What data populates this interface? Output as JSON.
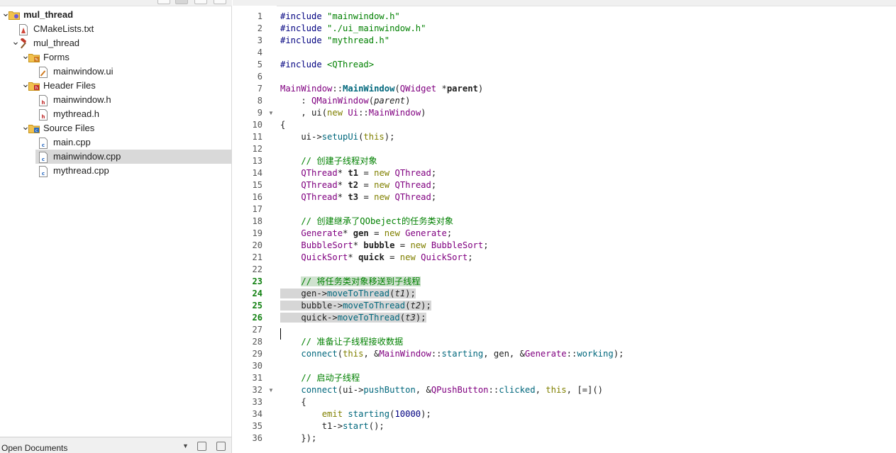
{
  "project_tree": [
    {
      "label": "mul_thread",
      "depth": 0,
      "arrow": "down",
      "icon": "project-icon",
      "bold": true
    },
    {
      "label": "CMakeLists.txt",
      "depth": 1,
      "arrow": "",
      "icon": "cmake-file-icon"
    },
    {
      "label": "mul_thread",
      "depth": 1,
      "arrow": "down",
      "icon": "hammer-icon"
    },
    {
      "label": "Forms",
      "depth": 2,
      "arrow": "down",
      "icon": "forms-folder-icon"
    },
    {
      "label": "mainwindow.ui",
      "depth": 3,
      "arrow": "",
      "icon": "ui-file-icon"
    },
    {
      "label": "Header Files",
      "depth": 2,
      "arrow": "down",
      "icon": "header-folder-icon"
    },
    {
      "label": "mainwindow.h",
      "depth": 3,
      "arrow": "",
      "icon": "header-file-icon"
    },
    {
      "label": "mythread.h",
      "depth": 3,
      "arrow": "",
      "icon": "header-file-icon"
    },
    {
      "label": "Source Files",
      "depth": 2,
      "arrow": "down",
      "icon": "source-folder-icon"
    },
    {
      "label": "main.cpp",
      "depth": 3,
      "arrow": "",
      "icon": "cpp-file-icon"
    },
    {
      "label": "mainwindow.cpp",
      "depth": 3,
      "arrow": "",
      "icon": "cpp-file-icon",
      "selected": true
    },
    {
      "label": "mythread.cpp",
      "depth": 3,
      "arrow": "",
      "icon": "cpp-file-icon"
    }
  ],
  "bottom_bar": {
    "label": "Open Documents"
  },
  "editor": {
    "current_lines": [
      23,
      24,
      25,
      26
    ],
    "lines": [
      {
        "n": 1,
        "tokens": [
          [
            "pp",
            "#include "
          ],
          [
            "str",
            "\"mainwindow.h\""
          ]
        ]
      },
      {
        "n": 2,
        "tokens": [
          [
            "pp",
            "#include "
          ],
          [
            "str",
            "\"./ui_mainwindow.h\""
          ]
        ]
      },
      {
        "n": 3,
        "tokens": [
          [
            "pp",
            "#include "
          ],
          [
            "str",
            "\"mythread.h\""
          ]
        ]
      },
      {
        "n": 4,
        "tokens": []
      },
      {
        "n": 5,
        "tokens": [
          [
            "pp",
            "#include "
          ],
          [
            "str",
            "<QThread>"
          ]
        ]
      },
      {
        "n": 6,
        "tokens": []
      },
      {
        "n": 7,
        "tokens": [
          [
            "ty",
            "MainWindow"
          ],
          [
            "",
            "::"
          ],
          [
            "fn b",
            "MainWindow"
          ],
          [
            "",
            "("
          ],
          [
            "ty",
            "QWidget"
          ],
          [
            "",
            " *"
          ],
          [
            "b",
            "parent"
          ],
          [
            "",
            ")"
          ]
        ]
      },
      {
        "n": 8,
        "tokens": [
          [
            "",
            "    : "
          ],
          [
            "ty",
            "QMainWindow"
          ],
          [
            "",
            "("
          ],
          [
            "it",
            "parent"
          ],
          [
            "",
            ")"
          ]
        ]
      },
      {
        "n": 9,
        "fold": true,
        "tokens": [
          [
            "",
            "    , ui("
          ],
          [
            "kw",
            "new"
          ],
          [
            "",
            " "
          ],
          [
            "ty",
            "Ui"
          ],
          [
            "",
            "::"
          ],
          [
            "ty",
            "MainWindow"
          ],
          [
            "",
            ")"
          ]
        ]
      },
      {
        "n": 10,
        "tokens": [
          [
            "",
            "{"
          ]
        ]
      },
      {
        "n": 11,
        "tokens": [
          [
            "",
            "    ui->"
          ],
          [
            "fn",
            "setupUi"
          ],
          [
            "",
            "("
          ],
          [
            "kw",
            "this"
          ],
          [
            "",
            ");"
          ]
        ]
      },
      {
        "n": 12,
        "tokens": []
      },
      {
        "n": 13,
        "tokens": [
          [
            "cmt",
            "    // 创建子线程对象"
          ]
        ]
      },
      {
        "n": 14,
        "tokens": [
          [
            "",
            "    "
          ],
          [
            "ty",
            "QThread"
          ],
          [
            "",
            "* "
          ],
          [
            "b",
            "t1"
          ],
          [
            "",
            " = "
          ],
          [
            "kw",
            "new"
          ],
          [
            "",
            " "
          ],
          [
            "ty",
            "QThread"
          ],
          [
            "",
            ";"
          ]
        ]
      },
      {
        "n": 15,
        "tokens": [
          [
            "",
            "    "
          ],
          [
            "ty",
            "QThread"
          ],
          [
            "",
            "* "
          ],
          [
            "b",
            "t2"
          ],
          [
            "",
            " = "
          ],
          [
            "kw",
            "new"
          ],
          [
            "",
            " "
          ],
          [
            "ty",
            "QThread"
          ],
          [
            "",
            ";"
          ]
        ]
      },
      {
        "n": 16,
        "tokens": [
          [
            "",
            "    "
          ],
          [
            "ty",
            "QThread"
          ],
          [
            "",
            "* "
          ],
          [
            "b",
            "t3"
          ],
          [
            "",
            " = "
          ],
          [
            "kw",
            "new"
          ],
          [
            "",
            " "
          ],
          [
            "ty",
            "QThread"
          ],
          [
            "",
            ";"
          ]
        ]
      },
      {
        "n": 17,
        "tokens": []
      },
      {
        "n": 18,
        "tokens": [
          [
            "cmt",
            "    // 创建继承了QObeject的任务类对象"
          ]
        ]
      },
      {
        "n": 19,
        "tokens": [
          [
            "",
            "    "
          ],
          [
            "ty",
            "Generate"
          ],
          [
            "",
            "* "
          ],
          [
            "b",
            "gen"
          ],
          [
            "",
            " = "
          ],
          [
            "kw",
            "new"
          ],
          [
            "",
            " "
          ],
          [
            "ty",
            "Generate"
          ],
          [
            "",
            ";"
          ]
        ]
      },
      {
        "n": 20,
        "tokens": [
          [
            "",
            "    "
          ],
          [
            "ty",
            "BubbleSort"
          ],
          [
            "",
            "* "
          ],
          [
            "b",
            "bubble"
          ],
          [
            "",
            " = "
          ],
          [
            "kw",
            "new"
          ],
          [
            "",
            " "
          ],
          [
            "ty",
            "BubbleSort"
          ],
          [
            "",
            ";"
          ]
        ]
      },
      {
        "n": 21,
        "tokens": [
          [
            "",
            "    "
          ],
          [
            "ty",
            "QuickSort"
          ],
          [
            "",
            "* "
          ],
          [
            "b",
            "quick"
          ],
          [
            "",
            " = "
          ],
          [
            "kw",
            "new"
          ],
          [
            "",
            " "
          ],
          [
            "ty",
            "QuickSort"
          ],
          [
            "",
            ";"
          ]
        ]
      },
      {
        "n": 22,
        "tokens": []
      },
      {
        "n": 23,
        "sel": "cmt",
        "tokens": [
          [
            "cmt",
            "// 将任务类对象移送到子线程"
          ]
        ]
      },
      {
        "n": 24,
        "sel": "full",
        "tokens": [
          [
            "",
            "    gen->"
          ],
          [
            "fn",
            "moveToThread"
          ],
          [
            "",
            "("
          ],
          [
            "it",
            "t1"
          ],
          [
            "",
            ");"
          ]
        ]
      },
      {
        "n": 25,
        "sel": "full",
        "tokens": [
          [
            "",
            "    bubble->"
          ],
          [
            "fn",
            "moveToThread"
          ],
          [
            "",
            "("
          ],
          [
            "it",
            "t2"
          ],
          [
            "",
            ");"
          ]
        ]
      },
      {
        "n": 26,
        "sel": "full",
        "tokens": [
          [
            "",
            "    quick->"
          ],
          [
            "fn",
            "moveToThread"
          ],
          [
            "",
            "("
          ],
          [
            "it",
            "t3"
          ],
          [
            "",
            ");"
          ]
        ]
      },
      {
        "n": 27,
        "tokens": []
      },
      {
        "n": 28,
        "tokens": [
          [
            "cmt",
            "    // 准备让子线程接收数据"
          ]
        ]
      },
      {
        "n": 29,
        "tokens": [
          [
            "",
            "    "
          ],
          [
            "fn",
            "connect"
          ],
          [
            "",
            "("
          ],
          [
            "kw",
            "this"
          ],
          [
            "",
            ", &"
          ],
          [
            "ty",
            "MainWindow"
          ],
          [
            "",
            "::"
          ],
          [
            "fn",
            "starting"
          ],
          [
            "",
            ", gen, &"
          ],
          [
            "ty",
            "Generate"
          ],
          [
            "",
            "::"
          ],
          [
            "fn",
            "working"
          ],
          [
            "",
            ");"
          ]
        ]
      },
      {
        "n": 30,
        "tokens": []
      },
      {
        "n": 31,
        "tokens": [
          [
            "cmt",
            "    // 启动子线程"
          ]
        ]
      },
      {
        "n": 32,
        "fold": true,
        "tokens": [
          [
            "",
            "    "
          ],
          [
            "fn",
            "connect"
          ],
          [
            "",
            "(ui->"
          ],
          [
            "fn",
            "pushButton"
          ],
          [
            "",
            ", &"
          ],
          [
            "ty",
            "QPushButton"
          ],
          [
            "",
            "::"
          ],
          [
            "fn",
            "clicked"
          ],
          [
            "",
            ", "
          ],
          [
            "kw",
            "this"
          ],
          [
            "",
            ", [=]()"
          ]
        ]
      },
      {
        "n": 33,
        "tokens": [
          [
            "",
            "    {"
          ]
        ]
      },
      {
        "n": 34,
        "tokens": [
          [
            "",
            "        "
          ],
          [
            "kw",
            "emit"
          ],
          [
            "",
            " "
          ],
          [
            "fn",
            "starting"
          ],
          [
            "",
            "("
          ],
          [
            "num",
            "10000"
          ],
          [
            "",
            ");"
          ]
        ]
      },
      {
        "n": 35,
        "tokens": [
          [
            "",
            "        t1->"
          ],
          [
            "fn",
            "start"
          ],
          [
            "",
            "();"
          ]
        ]
      },
      {
        "n": 36,
        "tokens": [
          [
            "",
            "    });"
          ]
        ]
      }
    ]
  },
  "colors": {
    "selection": "#d6d6d6",
    "selected_row": "#d9d9d9",
    "comment": "#008000",
    "keyword": "#808000",
    "type": "#800080"
  }
}
